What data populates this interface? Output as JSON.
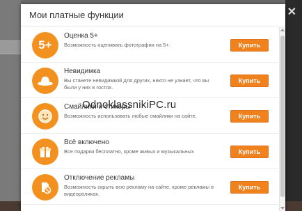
{
  "modal": {
    "title": "Мои платные функции"
  },
  "items": [
    {
      "icon": "five-plus-icon",
      "icon_text": "5+",
      "title": "Оценка 5+",
      "desc": "Возможность оценивать фотографии на 5+.",
      "button": "Купить"
    },
    {
      "icon": "hat-icon",
      "icon_text": "",
      "title": "Невидимка",
      "desc": "Вы станете невидимкой для других, никто не узнает, что вы были у них в гостях.",
      "button": "Купить"
    },
    {
      "icon": "smiley-icon",
      "icon_text": "",
      "title": "Смайлики и стикеры",
      "desc": "Возможность использовать любые смайлики на сайте.",
      "button": "Купить"
    },
    {
      "icon": "gift-icon",
      "icon_text": "",
      "title": "Всё включено",
      "desc": "Все подарки бесплатно, кроме живых и музыкальных",
      "button": "Купить"
    },
    {
      "icon": "no-ads-icon",
      "icon_text": "",
      "title": "Отключение рекламы",
      "desc": "Возможность скрыть всю рекламу на сайте, кроме рекламы в видеороликах.",
      "button": "Купить"
    }
  ],
  "watermark": "OdnoklassnikiPC.ru",
  "colors": {
    "accent": "#f39120",
    "button": "#f0821e"
  }
}
